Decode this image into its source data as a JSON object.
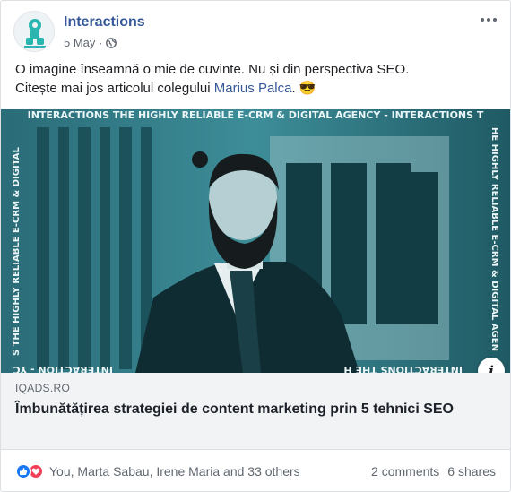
{
  "post": {
    "page_name": "Interactions",
    "date": "5 May",
    "separator": "·",
    "text_line1": "O imagine înseamnă o mie de cuvinte. Nu și din perspectiva SEO.",
    "text_line2_prefix": "Citește mai jos articolul colegului ",
    "mention": "Marius Palca",
    "text_line2_suffix": ".",
    "emoji": "😎"
  },
  "media": {
    "banner_top": "INTERACTIONS THE HIGHLY RELIABLE E-CRM & DIGITAL AGENCY - INTERACTIONS T",
    "banner_left": "S THE HIGHLY RELIABLE E-CRM & DIGITAL",
    "banner_right": "HE HIGHLY RELIABLE E-CRM & DIGITAL AGEN",
    "banner_bottom_left": "INTERACTION - YC",
    "banner_bottom_right": "INTERACTIONS THE H",
    "info_label": "i",
    "tint_color": "#1a5560"
  },
  "link": {
    "domain": "IQADS.RO",
    "title": "Îmbunătățirea strategiei de content marketing prin 5 tehnici SEO"
  },
  "footer": {
    "reaction_names": "You, Marta Sabau, Irene Maria and 33 others",
    "comments": "2 comments",
    "shares": "6 shares"
  },
  "colors": {
    "link_blue": "#365899",
    "like_blue": "#1877f2",
    "love_red": "#f33e58",
    "brand_teal": "#2ab5b0"
  },
  "icons": {
    "avatar": "interactions-logo-icon",
    "privacy": "globe-icon",
    "menu": "more-horizontal-icon",
    "like": "like-reaction-icon",
    "love": "love-reaction-icon"
  }
}
